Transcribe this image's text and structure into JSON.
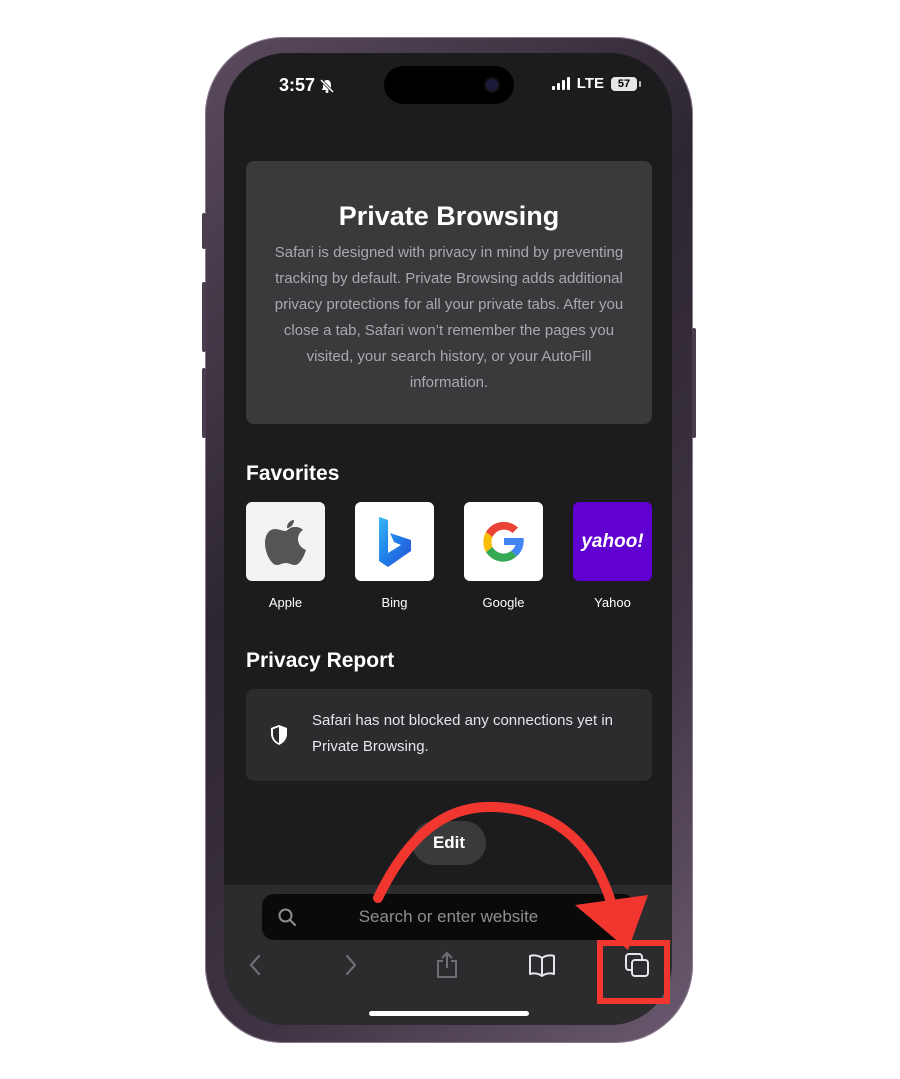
{
  "status_bar": {
    "time": "3:57",
    "network": "LTE",
    "battery": "57"
  },
  "private_browsing": {
    "title": "Private Browsing",
    "body": "Safari is designed with privacy in mind by preventing tracking by default. Private Browsing adds additional privacy protections for all your private tabs. After you close a tab, Safari won’t remember the pages you visited, your search history, or your AutoFill information."
  },
  "favorites": {
    "title": "Favorites",
    "items": [
      {
        "label": "Apple",
        "icon": "apple-logo-icon",
        "bg": "#f2f2f2"
      },
      {
        "label": "Bing",
        "icon": "bing-logo-icon",
        "bg": "#ffffff"
      },
      {
        "label": "Google",
        "icon": "google-logo-icon",
        "bg": "#ffffff"
      },
      {
        "label": "Yahoo",
        "icon": "yahoo-logo-icon",
        "bg": "#6001d2",
        "tile_text": "yahoo!"
      }
    ]
  },
  "privacy_report": {
    "title": "Privacy Report",
    "message": "Safari has not blocked any connections yet in Private Browsing."
  },
  "edit_button": "Edit",
  "search": {
    "placeholder": "Search or enter website"
  },
  "toolbar": {
    "buttons": [
      "back-icon",
      "forward-icon",
      "share-icon",
      "bookmarks-icon",
      "tabs-icon"
    ]
  },
  "annotation_colors": {
    "arrow": "#f0362f",
    "highlight_box": "#f0362f"
  }
}
